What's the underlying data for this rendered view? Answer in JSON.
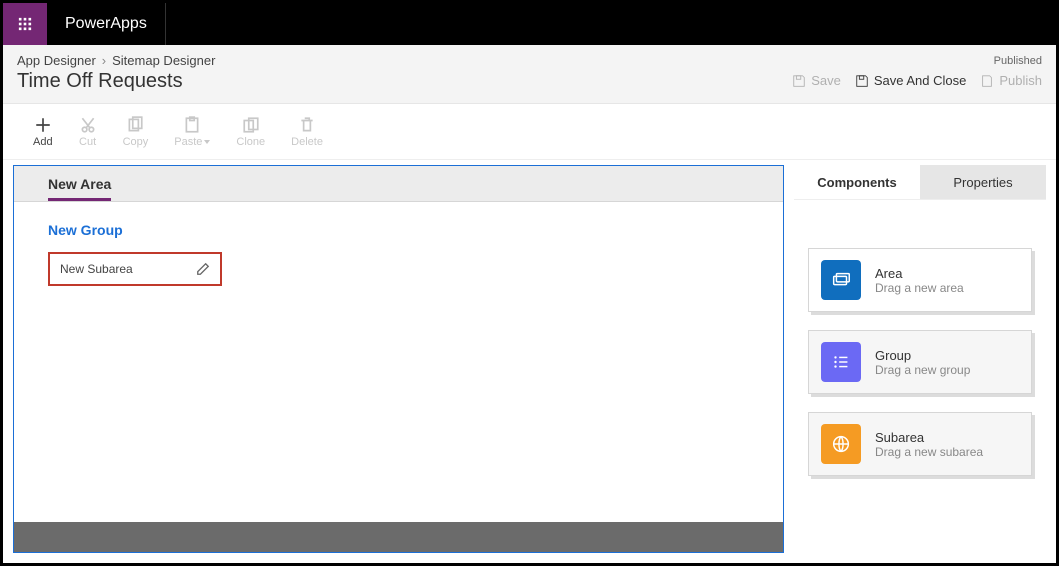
{
  "branding": {
    "app_name": "PowerApps"
  },
  "breadcrumb": {
    "root": "App Designer",
    "current": "Sitemap Designer"
  },
  "page": {
    "title": "Time Off Requests",
    "status": "Published"
  },
  "header_actions": {
    "save": "Save",
    "save_and_close": "Save And Close",
    "publish": "Publish"
  },
  "toolbar": {
    "add": "Add",
    "cut": "Cut",
    "copy": "Copy",
    "paste": "Paste",
    "clone": "Clone",
    "delete": "Delete"
  },
  "sitemap": {
    "area": "New Area",
    "group": "New Group",
    "subarea": "New Subarea"
  },
  "side": {
    "tabs": {
      "components": "Components",
      "properties": "Properties"
    },
    "area": {
      "title": "Area",
      "sub": "Drag a new area"
    },
    "group": {
      "title": "Group",
      "sub": "Drag a new group"
    },
    "subarea": {
      "title": "Subarea",
      "sub": "Drag a new subarea"
    }
  }
}
